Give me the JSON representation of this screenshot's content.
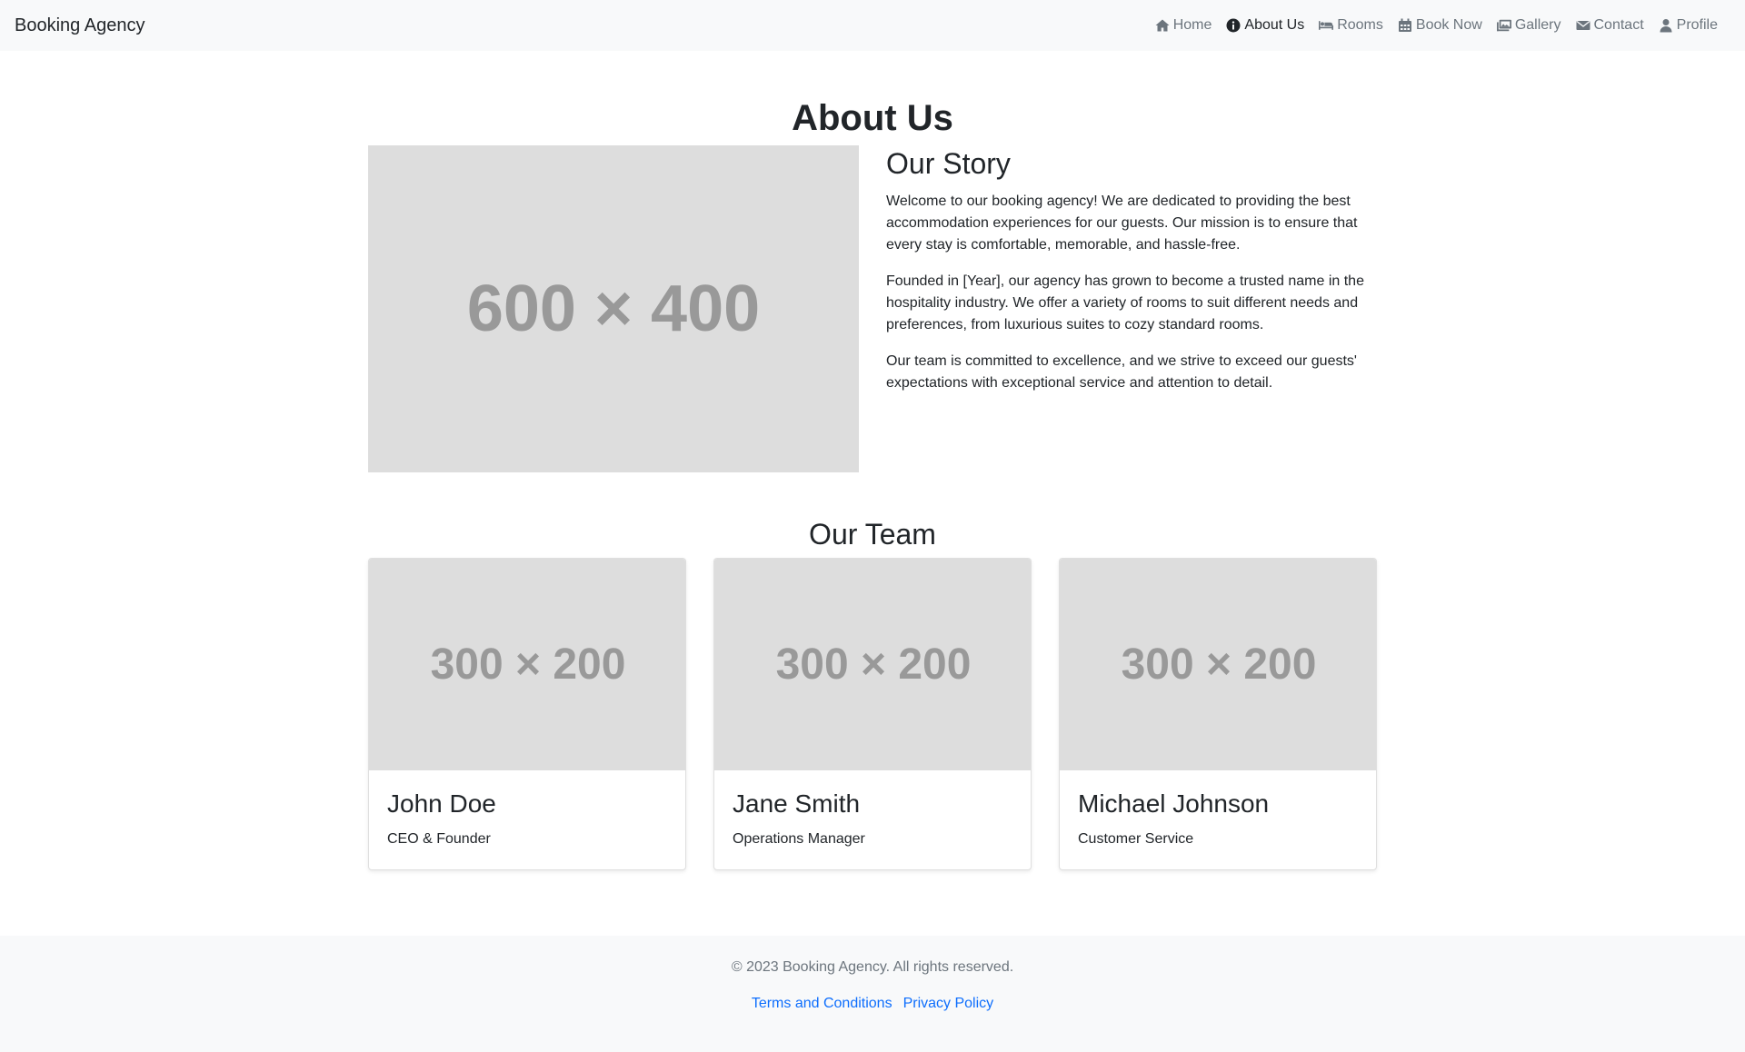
{
  "navbar": {
    "brand": "Booking Agency",
    "items": [
      {
        "label": "Home",
        "icon": "home-icon"
      },
      {
        "label": "About Us",
        "icon": "info-icon"
      },
      {
        "label": "Rooms",
        "icon": "bed-icon"
      },
      {
        "label": "Book Now",
        "icon": "calendar-icon"
      },
      {
        "label": "Gallery",
        "icon": "images-icon"
      },
      {
        "label": "Contact",
        "icon": "envelope-icon"
      },
      {
        "label": "Profile",
        "icon": "user-icon"
      }
    ],
    "active": "About Us"
  },
  "main": {
    "title": "About Us",
    "story_image_label": "600 × 400",
    "story": {
      "heading": "Our Story",
      "paragraphs": [
        "Welcome to our booking agency! We are dedicated to providing the best accommodation experiences for our guests. Our mission is to ensure that every stay is comfortable, memorable, and hassle-free.",
        "Founded in [Year], our agency has grown to become a trusted name in the hospitality industry. We offer a variety of rooms to suit different needs and preferences, from luxurious suites to cozy standard rooms.",
        "Our team is committed to excellence, and we strive to exceed our guests' expectations with exceptional service and attention to detail."
      ]
    },
    "team": {
      "heading": "Our Team",
      "members": [
        {
          "image_label": "300 × 200",
          "name": "John Doe",
          "role": "CEO & Founder"
        },
        {
          "image_label": "300 × 200",
          "name": "Jane Smith",
          "role": "Operations Manager"
        },
        {
          "image_label": "300 × 200",
          "name": "Michael Johnson",
          "role": "Customer Service"
        }
      ]
    }
  },
  "footer": {
    "copyright": "© 2023 Booking Agency. All rights reserved.",
    "links": [
      "Terms and Conditions",
      "Privacy Policy"
    ]
  },
  "colors": {
    "navbar_bg": "#f8f9fa",
    "link": "#0d6efd",
    "muted": "#6c757d",
    "placeholder_bg": "#dddddd"
  }
}
